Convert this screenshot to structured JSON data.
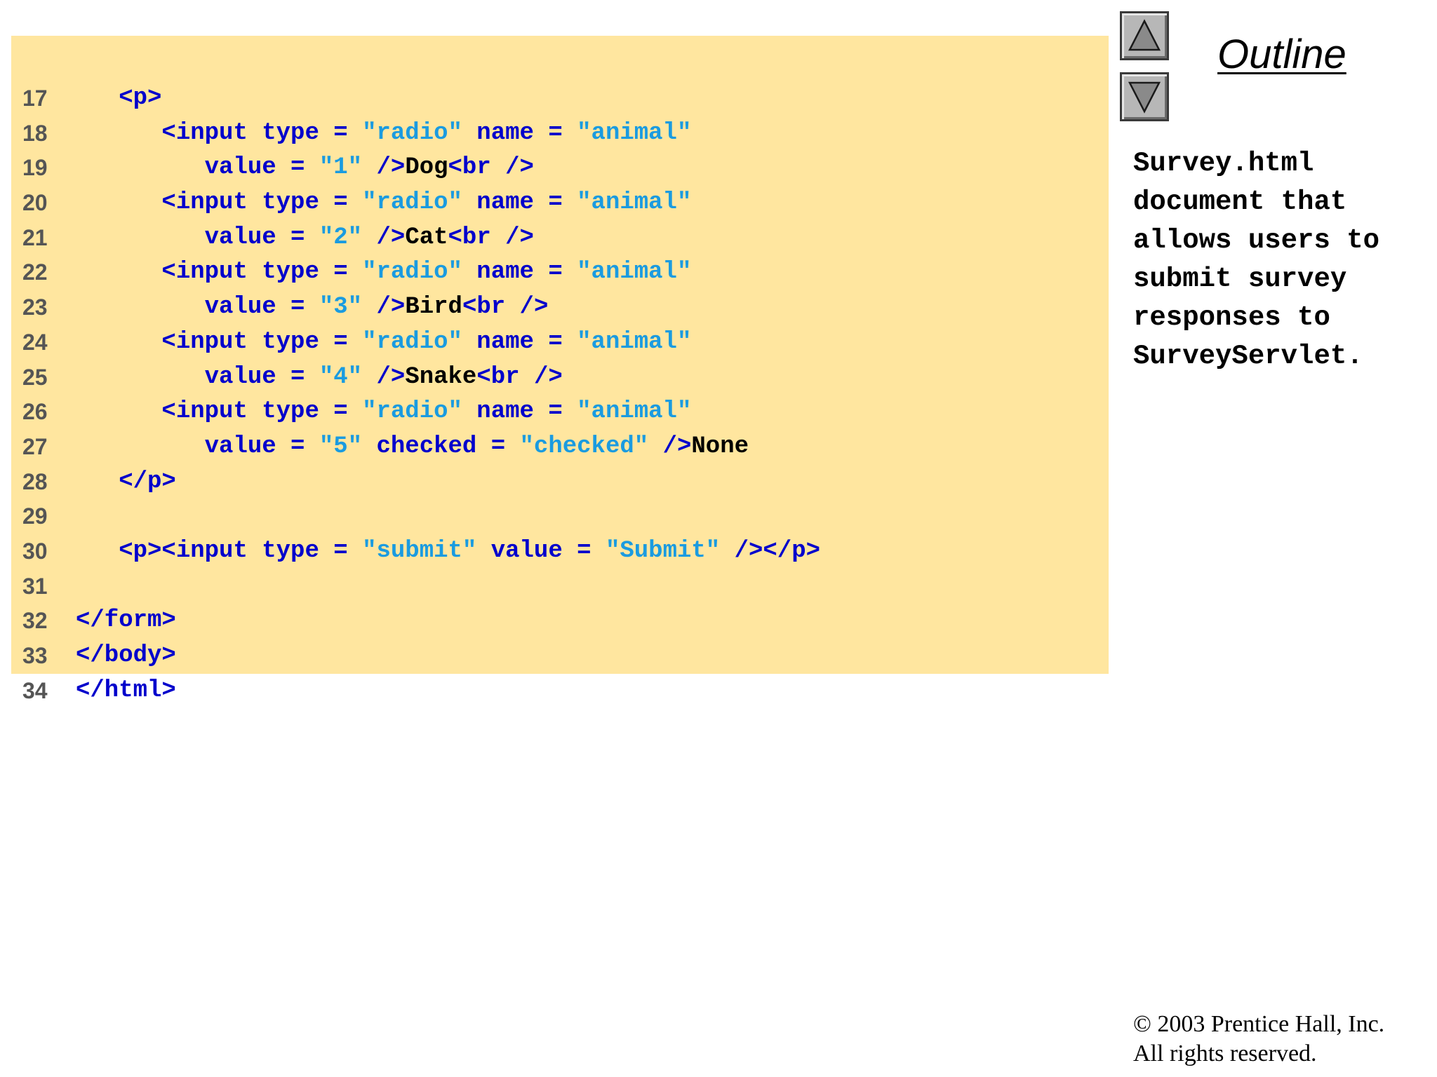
{
  "code": {
    "lines": [
      {
        "num": "17",
        "tokens": [
          {
            "t": "   ",
            "k": "text"
          },
          {
            "t": "<p>",
            "k": "tag"
          }
        ]
      },
      {
        "num": "18",
        "tokens": [
          {
            "t": "      ",
            "k": "text"
          },
          {
            "t": "<input type = ",
            "k": "tag"
          },
          {
            "t": "\"radio\"",
            "k": "str"
          },
          {
            "t": " name = ",
            "k": "tag"
          },
          {
            "t": "\"animal\"",
            "k": "str"
          }
        ]
      },
      {
        "num": "19",
        "tokens": [
          {
            "t": "         ",
            "k": "text"
          },
          {
            "t": "value = ",
            "k": "tag"
          },
          {
            "t": "\"1\"",
            "k": "str"
          },
          {
            "t": " />",
            "k": "tag"
          },
          {
            "t": "Dog",
            "k": "text"
          },
          {
            "t": "<br />",
            "k": "tag"
          }
        ]
      },
      {
        "num": "20",
        "tokens": [
          {
            "t": "      ",
            "k": "text"
          },
          {
            "t": "<input type = ",
            "k": "tag"
          },
          {
            "t": "\"radio\"",
            "k": "str"
          },
          {
            "t": " name = ",
            "k": "tag"
          },
          {
            "t": "\"animal\"",
            "k": "str"
          }
        ]
      },
      {
        "num": "21",
        "tokens": [
          {
            "t": "         ",
            "k": "text"
          },
          {
            "t": "value = ",
            "k": "tag"
          },
          {
            "t": "\"2\"",
            "k": "str"
          },
          {
            "t": " />",
            "k": "tag"
          },
          {
            "t": "Cat",
            "k": "text"
          },
          {
            "t": "<br />",
            "k": "tag"
          }
        ]
      },
      {
        "num": "22",
        "tokens": [
          {
            "t": "      ",
            "k": "text"
          },
          {
            "t": "<input type = ",
            "k": "tag"
          },
          {
            "t": "\"radio\"",
            "k": "str"
          },
          {
            "t": " name = ",
            "k": "tag"
          },
          {
            "t": "\"animal\"",
            "k": "str"
          }
        ]
      },
      {
        "num": "23",
        "tokens": [
          {
            "t": "         ",
            "k": "text"
          },
          {
            "t": "value = ",
            "k": "tag"
          },
          {
            "t": "\"3\"",
            "k": "str"
          },
          {
            "t": " />",
            "k": "tag"
          },
          {
            "t": "Bird",
            "k": "text"
          },
          {
            "t": "<br />",
            "k": "tag"
          }
        ]
      },
      {
        "num": "24",
        "tokens": [
          {
            "t": "      ",
            "k": "text"
          },
          {
            "t": "<input type = ",
            "k": "tag"
          },
          {
            "t": "\"radio\"",
            "k": "str"
          },
          {
            "t": " name = ",
            "k": "tag"
          },
          {
            "t": "\"animal\"",
            "k": "str"
          }
        ]
      },
      {
        "num": "25",
        "tokens": [
          {
            "t": "         ",
            "k": "text"
          },
          {
            "t": "value = ",
            "k": "tag"
          },
          {
            "t": "\"4\"",
            "k": "str"
          },
          {
            "t": " />",
            "k": "tag"
          },
          {
            "t": "Snake",
            "k": "text"
          },
          {
            "t": "<br />",
            "k": "tag"
          }
        ]
      },
      {
        "num": "26",
        "tokens": [
          {
            "t": "      ",
            "k": "text"
          },
          {
            "t": "<input type = ",
            "k": "tag"
          },
          {
            "t": "\"radio\"",
            "k": "str"
          },
          {
            "t": " name = ",
            "k": "tag"
          },
          {
            "t": "\"animal\"",
            "k": "str"
          }
        ]
      },
      {
        "num": "27",
        "tokens": [
          {
            "t": "         ",
            "k": "text"
          },
          {
            "t": "value = ",
            "k": "tag"
          },
          {
            "t": "\"5\"",
            "k": "str"
          },
          {
            "t": " checked = ",
            "k": "tag"
          },
          {
            "t": "\"checked\"",
            "k": "str"
          },
          {
            "t": " />",
            "k": "tag"
          },
          {
            "t": "None",
            "k": "text"
          }
        ]
      },
      {
        "num": "28",
        "tokens": [
          {
            "t": "   ",
            "k": "text"
          },
          {
            "t": "</p>",
            "k": "tag"
          }
        ]
      },
      {
        "num": "29",
        "tokens": []
      },
      {
        "num": "30",
        "tokens": [
          {
            "t": "   ",
            "k": "text"
          },
          {
            "t": "<p><input type = ",
            "k": "tag"
          },
          {
            "t": "\"submit\"",
            "k": "str"
          },
          {
            "t": " value = ",
            "k": "tag"
          },
          {
            "t": "\"Submit\"",
            "k": "str"
          },
          {
            "t": " /></p>",
            "k": "tag"
          }
        ]
      },
      {
        "num": "31",
        "tokens": []
      },
      {
        "num": "32",
        "tokens": [
          {
            "t": "</form>",
            "k": "tag"
          }
        ]
      },
      {
        "num": "33",
        "tokens": [
          {
            "t": "</body>",
            "k": "tag"
          }
        ]
      },
      {
        "num": "34",
        "tokens": [
          {
            "t": "</html>",
            "k": "tag"
          }
        ]
      }
    ]
  },
  "outline": {
    "title": "Outline",
    "note": "Survey.html document that allows users to submit survey responses to SurveyServlet."
  },
  "nav": {
    "up_icon": "triangle-up-icon",
    "down_icon": "triangle-down-icon"
  },
  "footer": {
    "copyright_line1": "© 2003 Prentice Hall, Inc.",
    "copyright_line2": "All rights reserved."
  },
  "colors": {
    "panel_bg": "#ffe69f",
    "tag": "#0000cc",
    "string": "#1a9be0",
    "text": "#000000"
  }
}
